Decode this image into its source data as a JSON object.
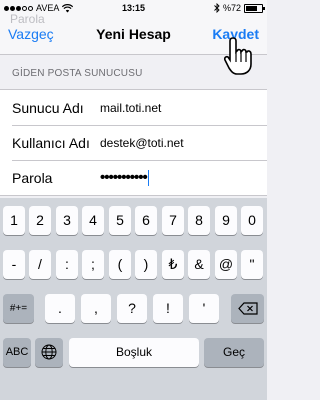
{
  "status": {
    "carrier": "AVEA",
    "time": "13:15",
    "battery": "%72"
  },
  "background_peek": "Parola",
  "nav": {
    "cancel": "Vazgeç",
    "title": "Yeni Hesap",
    "save": "Kaydet"
  },
  "section_header": "GİDEN POSTA SUNUCUSU",
  "rows": [
    {
      "label": "Sunucu Adı",
      "value": "mail.toti.net"
    },
    {
      "label": "Kullanıcı Adı",
      "value": "destek@toti.net"
    },
    {
      "label": "Parola",
      "value": "•••••••••••"
    }
  ],
  "keyboard": {
    "row1": [
      "1",
      "2",
      "3",
      "4",
      "5",
      "6",
      "7",
      "8",
      "9",
      "0"
    ],
    "row2": [
      "-",
      "/",
      ":",
      ";",
      "(",
      ")",
      "₺",
      "&",
      "@",
      "\""
    ],
    "row3_left": "#+=",
    "row3": [
      ".",
      ",",
      "?",
      "!",
      "'"
    ],
    "abc": "ABC",
    "space": "Boşluk",
    "go": "Geç"
  }
}
